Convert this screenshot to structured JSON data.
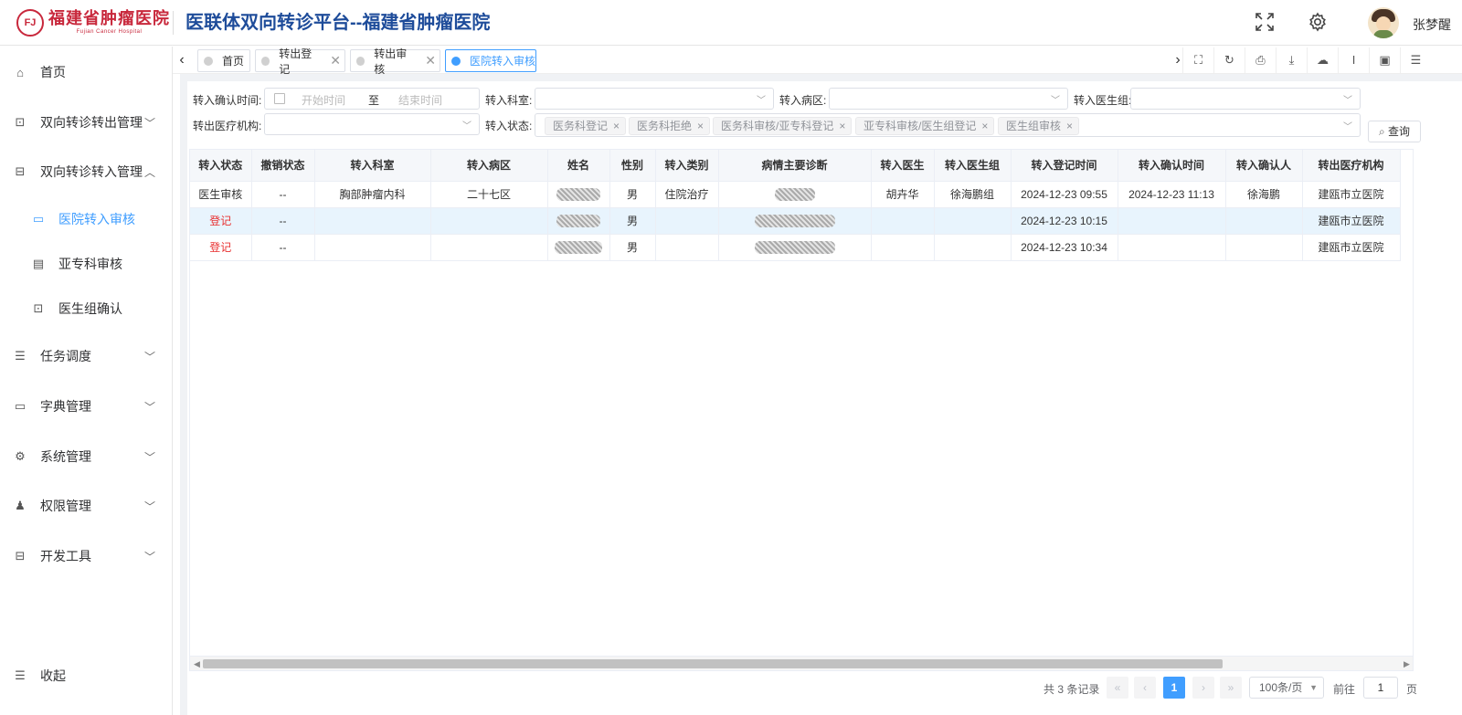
{
  "header": {
    "logo_cn": "福建省肿瘤医院",
    "logo_en": "Fujian Cancer Hospital",
    "title": "医联体双向转诊平台--福建省肿瘤医院",
    "username": "张梦醒"
  },
  "sidebar": {
    "items": [
      {
        "label": "首页",
        "icon": "home-icon"
      },
      {
        "label": "双向转诊转出管理",
        "icon": "terminal-icon"
      },
      {
        "label": "双向转诊转入管理",
        "icon": "code-icon"
      },
      {
        "label": "医院转入审核",
        "icon": "book-icon"
      },
      {
        "label": "亚专科审核",
        "icon": "document-icon"
      },
      {
        "label": "医生组确认",
        "icon": "terminal-icon"
      },
      {
        "label": "任务调度",
        "icon": "task-icon"
      },
      {
        "label": "字典管理",
        "icon": "book-icon"
      },
      {
        "label": "系统管理",
        "icon": "gear-icon"
      },
      {
        "label": "权限管理",
        "icon": "user-key-icon"
      },
      {
        "label": "开发工具",
        "icon": "code-icon"
      }
    ],
    "collapse_label": "收起"
  },
  "tabs": [
    {
      "label": "首页"
    },
    {
      "label": "转出登记"
    },
    {
      "label": "转出审核"
    },
    {
      "label": "医院转入审核"
    }
  ],
  "filters": {
    "confirm_time_label": "转入确认时间:",
    "start_placeholder": "开始时间",
    "range_sep": "至",
    "end_placeholder": "结束时间",
    "dept_label": "转入科室:",
    "ward_label": "转入病区:",
    "group_label": "转入医生组:",
    "org_label": "转出医疗机构:",
    "status_label": "转入状态:",
    "status_tags": [
      "医务科登记",
      "医务科拒绝",
      "医务科审核/亚专科登记",
      "亚专科审核/医生组登记",
      "医生组审核"
    ],
    "query_label": "查询"
  },
  "table": {
    "columns": [
      "转入状态",
      "撤销状态",
      "转入科室",
      "转入病区",
      "姓名",
      "性别",
      "转入类别",
      "病情主要诊断",
      "转入医生",
      "转入医生组",
      "转入登记时间",
      "转入确认时间",
      "转入确认人",
      "转出医疗机构"
    ],
    "rows": [
      [
        "医生审核",
        "--",
        "胸部肿瘤内科",
        "二十七区",
        "",
        "男",
        "住院治疗",
        "",
        "胡卉华",
        "徐海鹏组",
        "2024-12-23 09:55",
        "2024-12-23 11:13",
        "徐海鹏",
        "建瓯市立医院"
      ],
      [
        "登记",
        "--",
        "",
        "",
        "",
        "男",
        "",
        "",
        "",
        "",
        "2024-12-23 10:15",
        "",
        "",
        "建瓯市立医院"
      ],
      [
        "登记",
        "--",
        "",
        "",
        "",
        "男",
        "",
        "",
        "",
        "",
        "2024-12-23 10:34",
        "",
        "",
        "建瓯市立医院"
      ]
    ]
  },
  "pager": {
    "total": "共 3 条记录",
    "current": "1",
    "size": "100条/页",
    "goto_label": "前往",
    "goto_value": "1",
    "unit": "页"
  },
  "colors": {
    "accent": "#409eff",
    "title": "#1e4c9a",
    "logo": "#c8283c",
    "status_red": "#e83030"
  }
}
